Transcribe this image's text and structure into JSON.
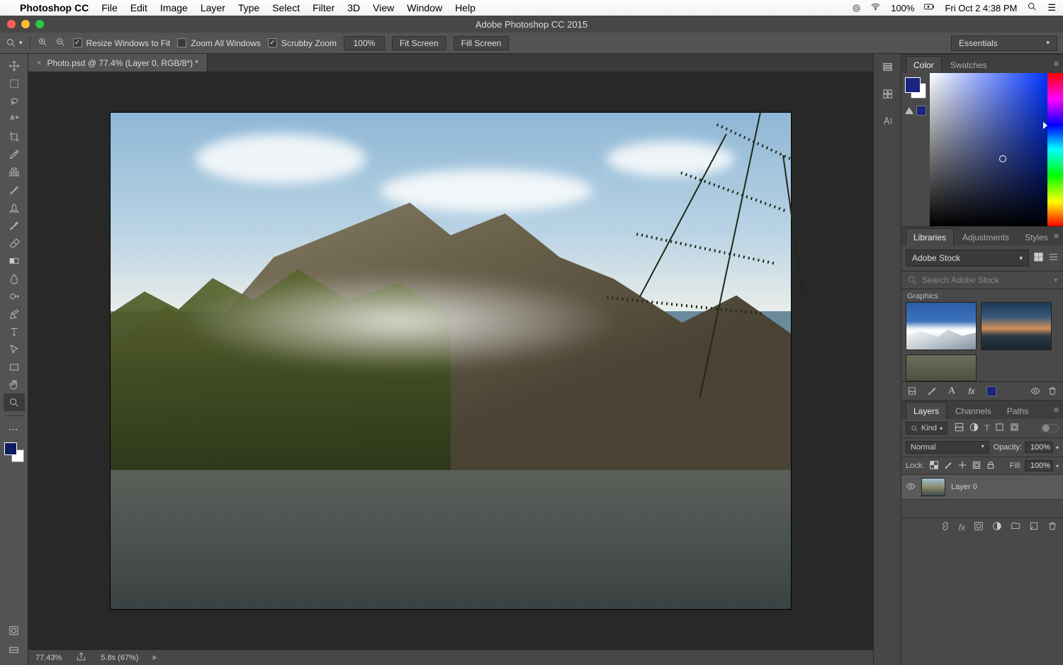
{
  "macmenu": {
    "app": "Photoshop CC",
    "items": [
      "File",
      "Edit",
      "Image",
      "Layer",
      "Type",
      "Select",
      "Filter",
      "3D",
      "View",
      "Window",
      "Help"
    ],
    "battery": "100%",
    "datetime": "Fri Oct 2  4:38 PM"
  },
  "window": {
    "title": "Adobe Photoshop CC 2015"
  },
  "options": {
    "resize_label": "Resize Windows to Fit",
    "zoom_all_label": "Zoom All Windows",
    "scrubby_label": "Scrubby Zoom",
    "zoom_value": "100%",
    "fit_screen": "Fit Screen",
    "fill_screen": "Fill Screen",
    "workspace": "Essentials"
  },
  "document": {
    "tab_label": "Photo.psd @ 77.4% (Layer 0, RGB/8*) *",
    "status_zoom": "77.43%",
    "status_timing": "5.8s (67%)"
  },
  "panels": {
    "color_tab": "Color",
    "swatches_tab": "Swatches",
    "libraries_tab": "Libraries",
    "adjustments_tab": "Adjustments",
    "styles_tab": "Styles",
    "layers_tab": "Layers",
    "channels_tab": "Channels",
    "paths_tab": "Paths"
  },
  "libraries": {
    "source": "Adobe Stock",
    "search_placeholder": "Search Adobe Stock",
    "section": "Graphics"
  },
  "layers": {
    "kind_label": "Kind",
    "blend_mode": "Normal",
    "opacity_label": "Opacity:",
    "opacity_value": "100%",
    "lock_label": "Lock:",
    "fill_label": "Fill:",
    "fill_value": "100%",
    "items": [
      {
        "name": "Layer 0"
      }
    ]
  }
}
